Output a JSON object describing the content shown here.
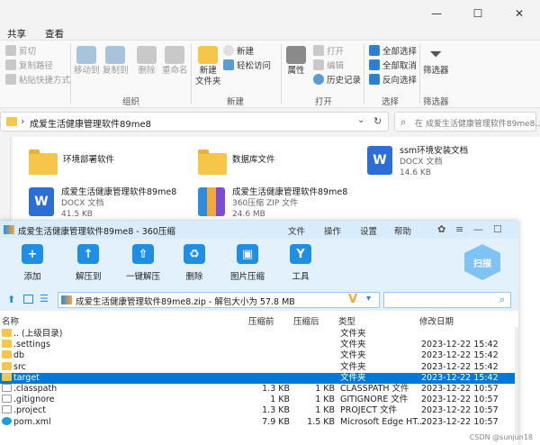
{
  "explorer": {
    "title": "成爱生活健康管理软件89me8",
    "window_controls": [
      "—",
      "☐",
      "✕"
    ],
    "menu": [
      "共享",
      "查看"
    ],
    "ribbon": {
      "cut": "剪切",
      "copy_path": "复制路径",
      "paste_shortcut": "粘贴快捷方式",
      "move_to": "移动到",
      "copy_to": "复制到",
      "delete": "删除",
      "rename": "重命名",
      "new_folder": "新建\n文件夹",
      "new_item": "新建",
      "easy_access": "轻松访问",
      "properties": "属性",
      "open": "打开",
      "edit": "编辑",
      "history": "历史记录",
      "select_all": "全部选择",
      "select_none": "全部取消",
      "invert": "反向选择",
      "filter": "筛选器",
      "groups": {
        "organize": "组织",
        "new": "新建",
        "open": "打开",
        "select": "选择",
        "filter": "筛选器"
      }
    },
    "address": {
      "path": "成爱生活健康管理软件89me8",
      "search_placeholder": "在 成爱生活健康管理软件89me8..."
    },
    "items": [
      {
        "name": "环境部署软件",
        "kind": "folder"
      },
      {
        "name": "数据库文件",
        "kind": "folder"
      },
      {
        "name": "ssm环境安装文档",
        "type": "DOCX 文档",
        "size": "14.6 KB",
        "kind": "word"
      },
      {
        "name": "成爱生活健康管理软件89me8",
        "type": "DOCX 文档",
        "size": "41.5 KB",
        "kind": "word"
      },
      {
        "name": "成爱生活健康管理软件89me8",
        "type": "360压缩 ZIP 文件",
        "size": "24.6 MB",
        "kind": "zip"
      }
    ]
  },
  "zip": {
    "title": "成爱生活健康管理软件89me8 - 360压缩",
    "tabs": [
      "文件",
      "操作",
      "设置",
      "帮助"
    ],
    "toolbar": [
      {
        "label": "添加",
        "icon": "add-icon",
        "glyph": "+"
      },
      {
        "label": "解压到",
        "icon": "extract-to-icon",
        "glyph": "↑"
      },
      {
        "label": "一键解压",
        "icon": "one-click-extract-icon",
        "glyph": "⇧"
      },
      {
        "label": "删除",
        "icon": "recycle-icon",
        "glyph": "♻"
      },
      {
        "label": "图片压缩",
        "icon": "image-compress-icon",
        "glyph": "▣"
      },
      {
        "label": "工具",
        "icon": "tools-icon",
        "glyph": "Y"
      }
    ],
    "scan_label": "扫描",
    "path": "成爱生活健康管理软件89me8.zip - 解包大小为 57.8 MB",
    "columns": [
      "名称",
      "压缩前",
      "压缩后",
      "类型",
      "修改日期"
    ],
    "rows": [
      {
        "name": ".. (上级目录)",
        "before": "",
        "after": "",
        "type": "文件夹",
        "date": "",
        "icon": "folder"
      },
      {
        "name": ".settings",
        "before": "",
        "after": "",
        "type": "文件夹",
        "date": "2023-12-22 15:42",
        "icon": "folder"
      },
      {
        "name": "db",
        "before": "",
        "after": "",
        "type": "文件夹",
        "date": "2023-12-22 15:42",
        "icon": "folder"
      },
      {
        "name": "src",
        "before": "",
        "after": "",
        "type": "文件夹",
        "date": "2023-12-22 15:42",
        "icon": "folder"
      },
      {
        "name": "target",
        "before": "",
        "after": "",
        "type": "文件夹",
        "date": "2023-12-22 15:42",
        "icon": "folder",
        "selected": true
      },
      {
        "name": ".classpath",
        "before": "1.3 KB",
        "after": "1 KB",
        "type": "CLASSPATH 文件",
        "date": "2023-12-22 10:57",
        "icon": "file"
      },
      {
        "name": ".gitignore",
        "before": "1 KB",
        "after": "1 KB",
        "type": "GITIGNORE 文件",
        "date": "2023-12-22 10:57",
        "icon": "file"
      },
      {
        "name": ".project",
        "before": "1.3 KB",
        "after": "1 KB",
        "type": "PROJECT 文件",
        "date": "2023-12-22 10:57",
        "icon": "file"
      },
      {
        "name": "pom.xml",
        "before": "7.9 KB",
        "after": "1.5 KB",
        "type": "Microsoft Edge HT...",
        "date": "2023-12-22 10:57",
        "icon": "edge"
      }
    ],
    "watermark": "CSDN @sunjun18"
  }
}
